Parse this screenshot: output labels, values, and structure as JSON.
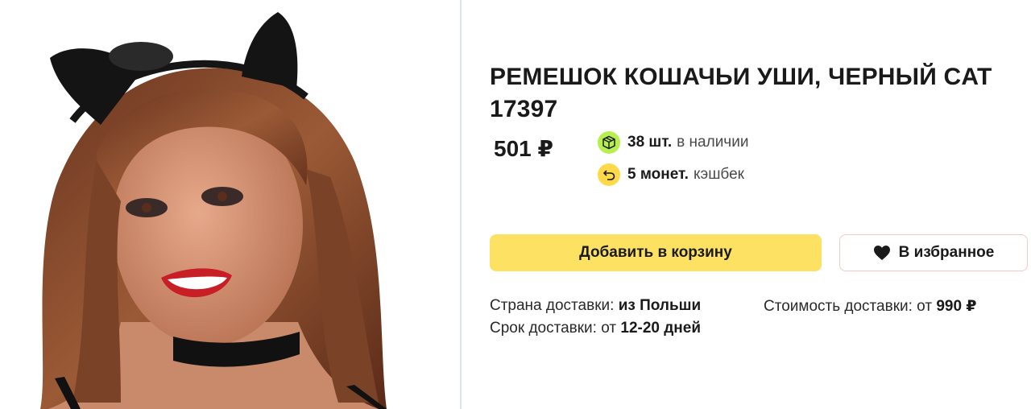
{
  "product": {
    "title": "РЕМЕШОК КОШАЧЬИ УШИ, ЧЕРНЫЙ CAT 17397",
    "price": "501 ₽",
    "image_alt": "product-photo-woman-with-cat-ears"
  },
  "stock": {
    "value": "38 шт.",
    "label": "в наличии"
  },
  "cashback": {
    "value": "5 монет.",
    "label": "кэшбек"
  },
  "actions": {
    "add_to_cart": "Добавить в корзину",
    "favorite": "В избранное"
  },
  "delivery": {
    "country_label": "Страна доставки:",
    "country_value": "из Польши",
    "term_label": "Срок доставки: от",
    "term_value": "12-20 дней",
    "cost_label": "Стоимость доставки: от",
    "cost_value": "990 ₽"
  },
  "colors": {
    "cart_button": "#fde162",
    "stock_icon_bg": "#b6ef4e",
    "cashback_icon_bg": "#ffd94a"
  },
  "icons": {
    "stock": "package-icon",
    "cashback": "cashback-return-icon",
    "favorite": "heart-icon"
  }
}
